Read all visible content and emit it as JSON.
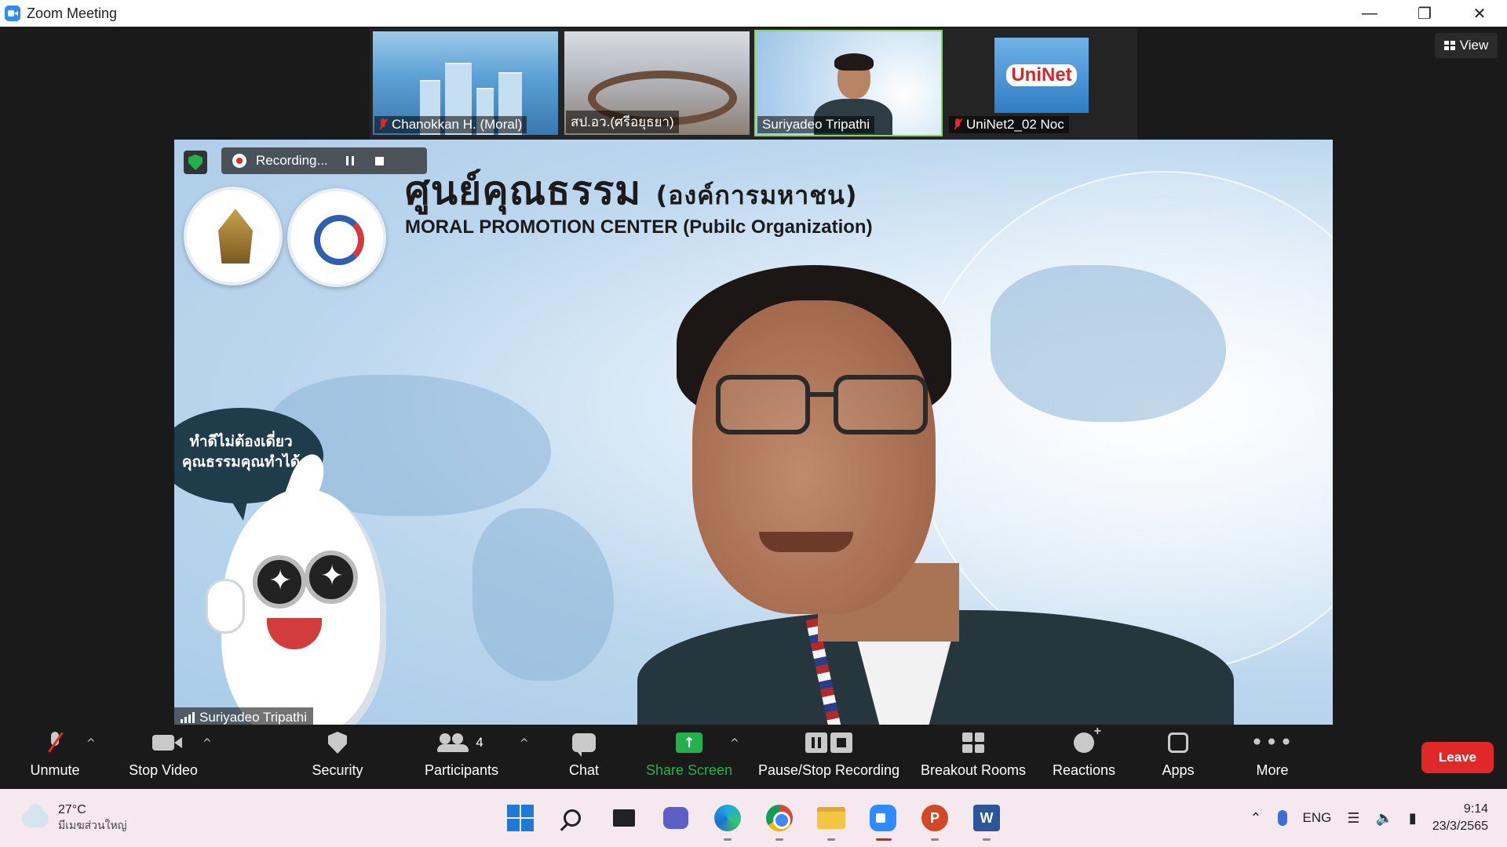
{
  "window": {
    "title": "Zoom Meeting"
  },
  "gallery": {
    "view_label": "View",
    "tiles": [
      {
        "name": "Chanokkan H. (Moral)",
        "muted": true,
        "active": false
      },
      {
        "name": "สป.อว.(ศรีอยุธยา)",
        "muted": false,
        "active": false
      },
      {
        "name": "Suriyadeo Tripathi",
        "muted": false,
        "active": true
      },
      {
        "name": "UniNet2_02 Noc",
        "muted": true,
        "active": false
      }
    ],
    "uninet_logo_text": "UniNet"
  },
  "main_video": {
    "speaker_name": "Suriyadeo Tripathi",
    "recording_label": "Recording...",
    "banner_title_th": "ศูนย์คุณธรรม",
    "banner_title_th_sub": "(องค์การมหาชน)",
    "banner_title_en": "MORAL PROMOTION CENTER  (Pubilc Organization)",
    "bubble_line1": "ทำดีไม่ต้องเดี่ยว",
    "bubble_line2": "คุณธรรมคุณทำได้"
  },
  "toolbar": {
    "unmute": "Unmute",
    "stop_video": "Stop Video",
    "security": "Security",
    "participants": "Participants",
    "participants_count": "4",
    "chat": "Chat",
    "share_screen": "Share Screen",
    "pause_stop_recording": "Pause/Stop Recording",
    "breakout_rooms": "Breakout Rooms",
    "reactions": "Reactions",
    "apps": "Apps",
    "more": "More",
    "leave": "Leave",
    "share_color": "#23b14d",
    "leave_color": "#e02828"
  },
  "taskbar": {
    "weather_temp": "27°C",
    "weather_desc": "มีเมฆส่วนใหญ่",
    "language": "ENG",
    "time": "9:14",
    "date": "23/3/2565"
  }
}
